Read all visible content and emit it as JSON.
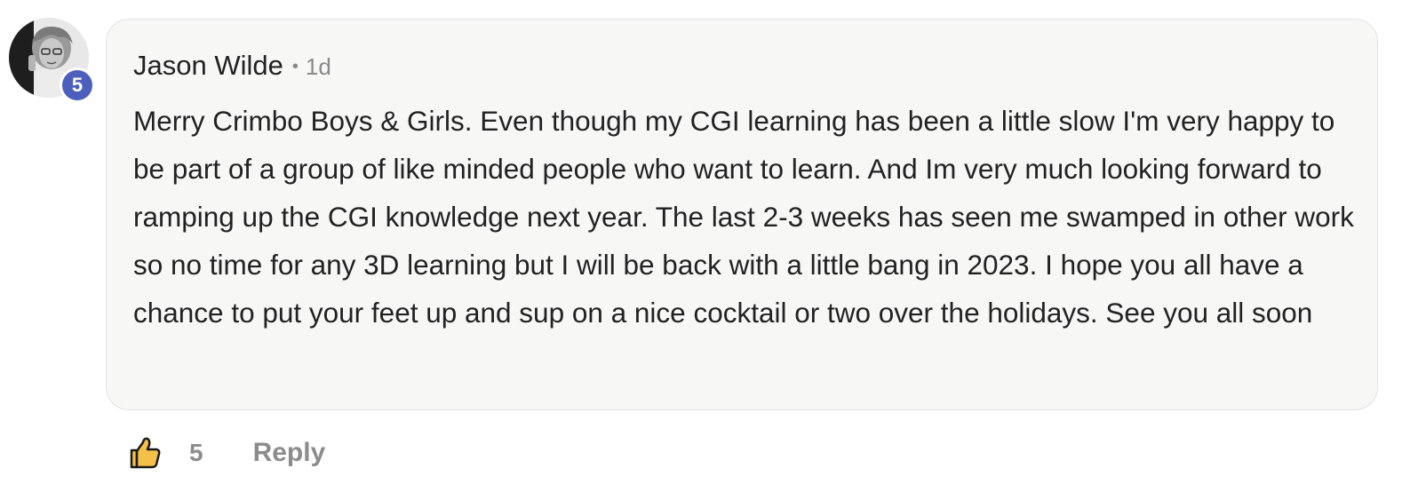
{
  "comment": {
    "author": "Jason Wilde",
    "separator": "•",
    "timestamp": "1d",
    "level_badge": "5",
    "body": "Merry Crimbo Boys & Girls. Even though my CGI learning has been a little slow I'm very happy to be part of a group of like minded people who want to learn. And Im very much looking forward to ramping up the CGI knowledge next year. The last 2-3 weeks has seen me swamped in other work so no time for any 3D learning but I will be back with a little bang in 2023. I hope you all have a chance to put your feet up and sup on a nice cocktail or two over the holidays. See you all soon"
  },
  "actions": {
    "like_icon": "thumbs-up-icon",
    "like_count": "5",
    "reply_label": "Reply"
  },
  "colors": {
    "badge": "#4c5fbd",
    "bubble_background": "#f7f7f6",
    "like_icon_fill": "#f5c04a",
    "muted_text": "#8c8c8c"
  }
}
